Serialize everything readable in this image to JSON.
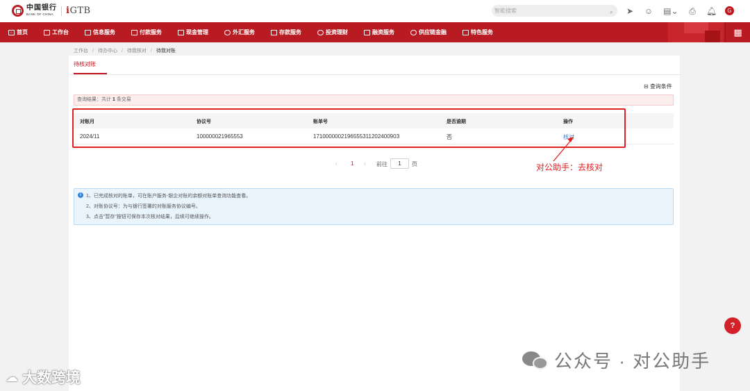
{
  "topbar": {
    "logo_cn": "中国银行",
    "logo_en": "BANK OF CHINA",
    "logo_gtb": "GTB",
    "search_placeholder": "智能搜索",
    "avatar_letter": "G"
  },
  "nav": {
    "items": [
      {
        "label": "首页"
      },
      {
        "label": "工作台"
      },
      {
        "label": "信息服务"
      },
      {
        "label": "付款服务"
      },
      {
        "label": "现金管理"
      },
      {
        "label": "外汇服务"
      },
      {
        "label": "存款服务"
      },
      {
        "label": "投资理财"
      },
      {
        "label": "融资服务"
      },
      {
        "label": "供应链金融"
      },
      {
        "label": "特色服务"
      }
    ]
  },
  "breadcrumb": [
    "工作台",
    "待办中心",
    "待我核对",
    "待我对账"
  ],
  "tab_label": "待核对账",
  "query_conditions_label": "查询条件",
  "result": {
    "prefix": "查询结果：共计",
    "count": "1",
    "suffix": "条交易"
  },
  "table": {
    "headers": [
      "对账月",
      "协议号",
      "账单号",
      "是否逾期",
      "操作"
    ],
    "rows": [
      {
        "month": "2024/11",
        "agreement": "100000021965553",
        "bill": "171000000219655531120240090З",
        "overdue": "否",
        "action": "核对"
      }
    ]
  },
  "pager": {
    "prev": "‹",
    "page": "1",
    "next": "›",
    "goto_label": "前往",
    "goto_value": "1",
    "unit": "页"
  },
  "annotation": "对公助手：去核对",
  "info": [
    "1、已完成核对的账单，可在账户服务-银企对账的余额对账单查询功能查看。",
    "2、对账协议号：为与银行签署的对账服务协议编号。",
    "3、点击\"暂存\"按钮可保存本次核对结果，后续可继续操作。"
  ],
  "watermark_right": "公众号 · 对公助手",
  "watermark_left": "大数跨境",
  "colors": {
    "brand_red": "#b81c22",
    "link_blue": "#3a7bd5",
    "annotation_red": "#e02020"
  }
}
